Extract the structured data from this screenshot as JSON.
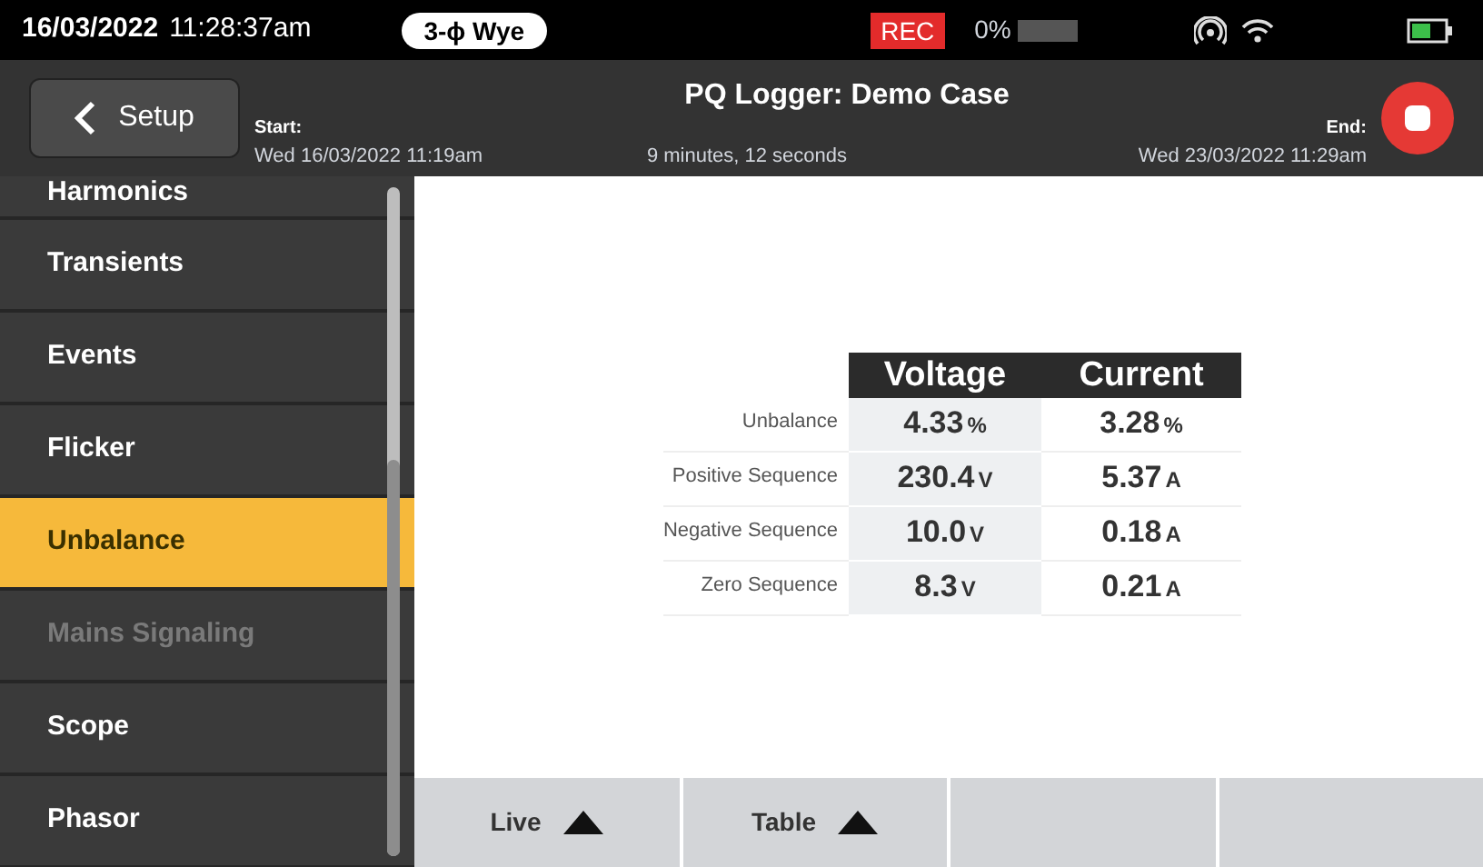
{
  "status_bar": {
    "date": "16/03/2022",
    "time": "11:28:37am",
    "wiring": "3-ϕ Wye",
    "recording": "REC",
    "storage": "0%"
  },
  "header": {
    "back_button": "Setup",
    "title": "PQ Logger: Demo Case",
    "start_label": "Start:",
    "start_time": "Wed 16/03/2022 11:19am",
    "duration": "9 minutes, 12 seconds",
    "end_label": "End:",
    "end_time": "Wed 23/03/2022 11:29am"
  },
  "sidebar": {
    "items": [
      {
        "label": "Harmonics",
        "selected": false,
        "disabled": false
      },
      {
        "label": "Transients",
        "selected": false,
        "disabled": false
      },
      {
        "label": "Events",
        "selected": false,
        "disabled": false
      },
      {
        "label": "Flicker",
        "selected": false,
        "disabled": false
      },
      {
        "label": "Unbalance",
        "selected": true,
        "disabled": false
      },
      {
        "label": "Mains Signaling",
        "selected": false,
        "disabled": true
      },
      {
        "label": "Scope",
        "selected": false,
        "disabled": false
      },
      {
        "label": "Phasor",
        "selected": false,
        "disabled": false
      }
    ]
  },
  "table": {
    "columns": [
      "Voltage",
      "Current"
    ],
    "rows": [
      {
        "label": "Unbalance",
        "voltage": "4.33",
        "voltage_unit": "%",
        "current": "3.28",
        "current_unit": "%"
      },
      {
        "label": "Positive Sequence",
        "voltage": "230.4",
        "voltage_unit": "V",
        "current": "5.37",
        "current_unit": "A"
      },
      {
        "label": "Negative Sequence",
        "voltage": "10.0",
        "voltage_unit": "V",
        "current": "0.18",
        "current_unit": "A"
      },
      {
        "label": "Zero Sequence",
        "voltage": "8.3",
        "voltage_unit": "V",
        "current": "0.21",
        "current_unit": "A"
      }
    ]
  },
  "bottom_buttons": [
    {
      "label": "Live"
    },
    {
      "label": "Table"
    }
  ]
}
